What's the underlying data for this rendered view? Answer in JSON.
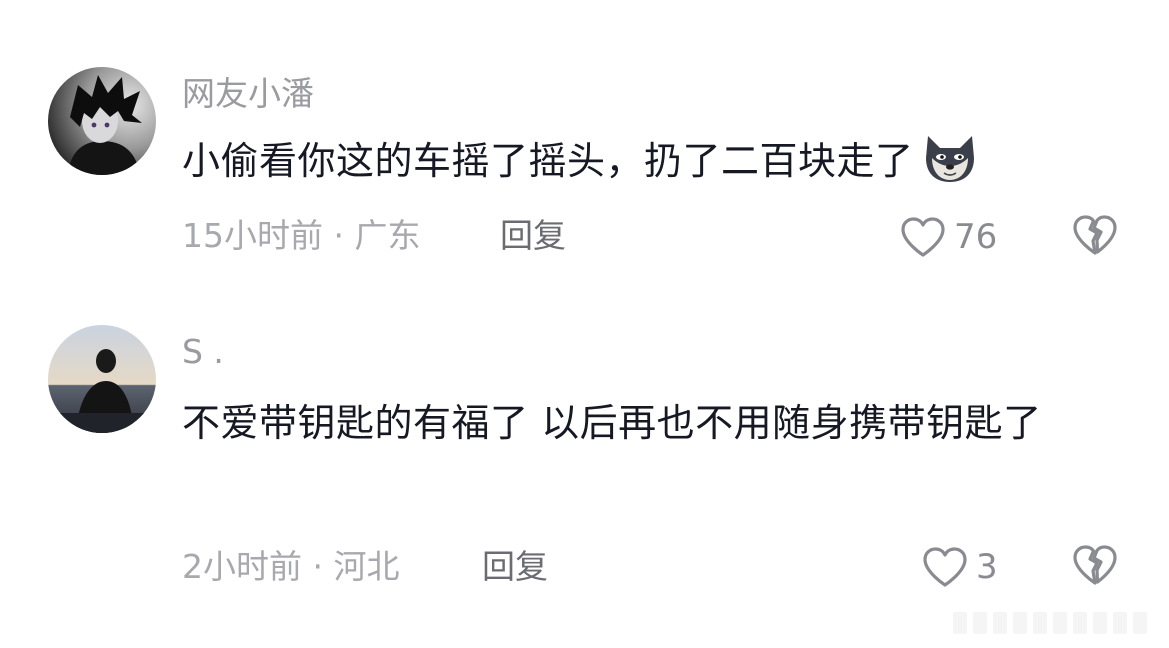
{
  "comments": [
    {
      "username": "网友小潘",
      "text": "小偷看你这的车摇了摇头，扔了二百块走了",
      "emoji": "doge-dog-emoji",
      "time": "15小时前",
      "location": "广东",
      "reply_label": "回复",
      "likes": "76"
    },
    {
      "username": "S .",
      "text": "不爱带钥匙的有福了 以后再也不用随身携带钥匙了",
      "time": "2小时前",
      "location": "河北",
      "reply_label": "回复",
      "likes": "3"
    }
  ],
  "meta_separator": " · ",
  "icons": {
    "like": "heart-outline-icon",
    "dislike": "broken-heart-icon"
  },
  "colors": {
    "username": "#9a9ba1",
    "body_text": "#161823",
    "meta": "#a8a9ae"
  }
}
